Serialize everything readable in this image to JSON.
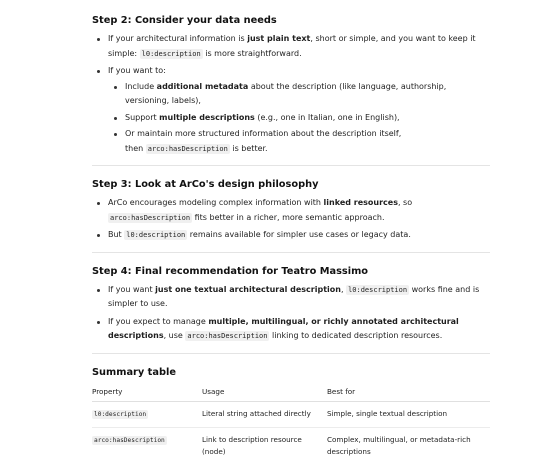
{
  "step2": {
    "title": "Step 2: Consider your data needs",
    "b1_pre": "If your architectural information is ",
    "b1_bold": "just plain text",
    "b1_post": ", short or simple, and you want to keep it simple: ",
    "b1_code": "l0:description",
    "b1_end": " is more straightforward.",
    "b2": "If you want to:",
    "sub1_pre": "Include ",
    "sub1_bold": "additional metadata",
    "sub1_post": " about the description (like language, authorship, versioning, labels),",
    "sub2_pre": "Support ",
    "sub2_bold": "multiple descriptions",
    "sub2_post": " (e.g., one in Italian, one in English),",
    "sub3_line1": "Or maintain more structured information about the description itself,",
    "sub3_pre": "then ",
    "sub3_code": "arco:hasDescription",
    "sub3_post": " is better."
  },
  "step3": {
    "title": "Step 3: Look at ArCo's design philosophy",
    "b1_pre": "ArCo encourages modeling complex information with ",
    "b1_bold": "linked resources",
    "b1_mid": ", so ",
    "b1_code": "arco:hasDescription",
    "b1_post": " fits better in a richer, more semantic approach.",
    "b2_pre": "But ",
    "b2_code": "l0:description",
    "b2_post": " remains available for simpler use cases or legacy data."
  },
  "step4": {
    "title": "Step 4: Final recommendation for Teatro Massimo",
    "b1_pre": "If you want ",
    "b1_bold": "just one textual architectural description",
    "b1_mid": ", ",
    "b1_code": "l0:description",
    "b1_post": " works fine and is simpler to use.",
    "b2_pre": "If you expect to manage ",
    "b2_bold": "multiple, multilingual, or richly annotated architectural descriptions",
    "b2_mid": ", use ",
    "b2_code": "arco:hasDescription",
    "b2_post": " linking to dedicated description resources."
  },
  "summary": {
    "title": "Summary table",
    "headers": [
      "Property",
      "Usage",
      "Best for"
    ],
    "rows": [
      {
        "property": "l0:description",
        "usage": "Literal string attached directly",
        "best_for": "Simple, single textual description"
      },
      {
        "property": "arco:hasDescription",
        "usage": "Link to description resource (node)",
        "best_for": "Complex, multilingual, or metadata-rich descriptions"
      }
    ]
  }
}
